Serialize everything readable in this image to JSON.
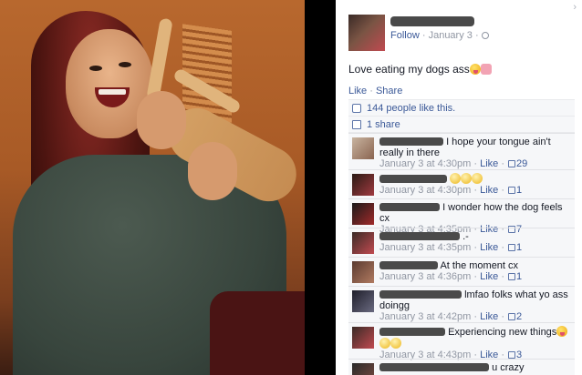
{
  "post": {
    "meta": {
      "follow": "Follow",
      "separator": " · ",
      "date": "January 3",
      "sep2": " · "
    },
    "caption": "Love eating my dogs ass",
    "actions": {
      "like": "Like",
      "dot": " · ",
      "share": "Share"
    },
    "likes_text": "144 people like this.",
    "shares_text": "1 share"
  },
  "comments": [
    {
      "text": "I hope your tongue ain't really in there",
      "time": "January 3 at 4:30pm",
      "like": "Like",
      "count": "29"
    },
    {
      "text": "",
      "time": "January 3 at 4:30pm",
      "like": "Like",
      "count": "1"
    },
    {
      "text": "I wonder how the dog feels cx",
      "time": "January 3 at 4:35pm",
      "like": "Like",
      "count": "7"
    },
    {
      "text": ".-",
      "time": "January 3 at 4:35pm",
      "like": "Like",
      "count": "1"
    },
    {
      "text": "At the moment cx",
      "time": "January 3 at 4:36pm",
      "like": "Like",
      "count": "1"
    },
    {
      "text": "lmfao folks what yo ass doingg",
      "time": "January 3 at 4:42pm",
      "like": "Like",
      "count": "2"
    },
    {
      "text": "Experiencing new things",
      "time": "January 3 at 4:43pm",
      "like": "Like",
      "count": "3"
    },
    {
      "text": "u crazy",
      "time": "",
      "like": "",
      "count": ""
    }
  ],
  "colors": {
    "link": "#3b5998",
    "meta": "#9197a3",
    "panel_bg": "#ffffff",
    "comment_bg": "#f6f7f9"
  },
  "icons": [
    "close-icon",
    "globe-icon",
    "like-thumb-icon",
    "share-icon",
    "smiley-emoji-icon",
    "heart-emoji-icon"
  ]
}
